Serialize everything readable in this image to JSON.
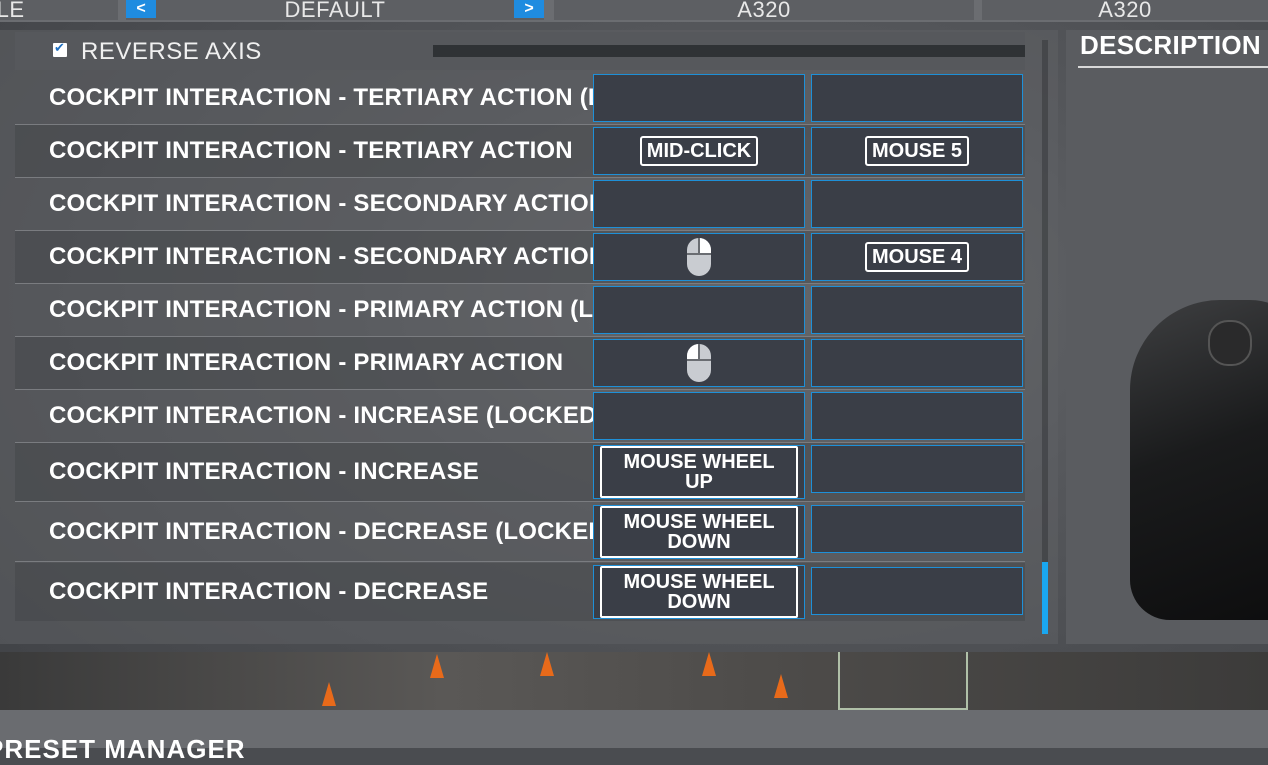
{
  "top_bar": {
    "cell_left": "ILE",
    "profile": "DEFAULT",
    "left_arrow": "<",
    "right_arrow": ">",
    "aircraft_1": "A320",
    "aircraft_2": "A320"
  },
  "reverse_axis": {
    "label": "REVERSE AXIS",
    "checked": true
  },
  "rows": [
    {
      "label": "COCKPIT INTERACTION - TERTIARY ACTION (LOCKED)",
      "input1": "",
      "input2": ""
    },
    {
      "label": "COCKPIT INTERACTION - TERTIARY ACTION",
      "input1": "MID-CLICK",
      "input2": "MOUSE 5"
    },
    {
      "label": "COCKPIT INTERACTION - SECONDARY ACTION (LOCKED)",
      "input1": "",
      "input2": ""
    },
    {
      "label": "COCKPIT INTERACTION - SECONDARY ACTION",
      "input1_icon": "mouse-right-button-icon",
      "input2": "MOUSE 4"
    },
    {
      "label": "COCKPIT INTERACTION - PRIMARY ACTION (LOCKED)",
      "input1": "",
      "input2": ""
    },
    {
      "label": "COCKPIT INTERACTION - PRIMARY ACTION",
      "input1_icon": "mouse-left-button-icon",
      "input2": ""
    },
    {
      "label": "COCKPIT INTERACTION - INCREASE (LOCKED)",
      "input1": "",
      "input2": ""
    },
    {
      "label": "COCKPIT INTERACTION - INCREASE",
      "input1_line1": "MOUSE WHEEL",
      "input1_line2": "UP",
      "input2": ""
    },
    {
      "label": "COCKPIT INTERACTION - DECREASE (LOCKED)",
      "input1_line1": "MOUSE WHEEL",
      "input1_line2": "DOWN",
      "input2": ""
    },
    {
      "label": "COCKPIT INTERACTION - DECREASE",
      "input1_line1": "MOUSE WHEEL",
      "input1_line2": "DOWN",
      "input2": ""
    }
  ],
  "description": {
    "title": "DESCRIPTION"
  },
  "bottom": {
    "title": "PRESET MANAGER"
  },
  "colors": {
    "accent": "#1aa7f0",
    "slot_bg": "#3a3e47",
    "slot_border": "#1e90d8"
  }
}
